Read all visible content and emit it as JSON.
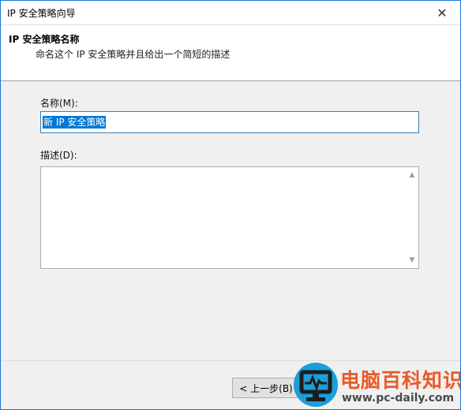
{
  "window": {
    "title": "IP 安全策略向导",
    "close_glyph": "✕"
  },
  "header": {
    "title": "IP 安全策略名称",
    "description": "命名这个 IP 安全策略并且给出一个简短的描述"
  },
  "form": {
    "name_label": "名称(M):",
    "name_value": "新 IP 安全策略",
    "description_label": "描述(D):",
    "description_value": ""
  },
  "footer": {
    "back_button_label": "< 上一步(B)"
  },
  "watermark": {
    "text": "电脑百科知识",
    "url": "www.pc-daily.com",
    "brand_color": "#e95a27",
    "logo_color": "#1a9fd8"
  }
}
